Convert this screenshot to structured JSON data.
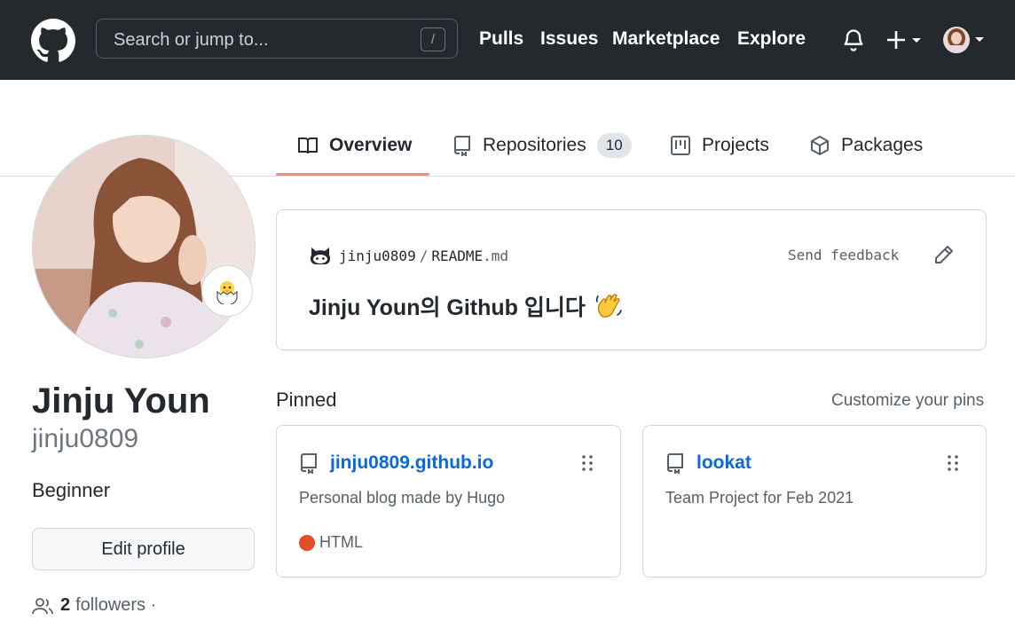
{
  "header": {
    "search_placeholder": "Search or jump to...",
    "search_shortcut": "/",
    "nav": [
      "Pulls",
      "Issues",
      "Marketplace",
      "Explore"
    ],
    "plus_icon": "plus-icon",
    "bell_icon": "bell-icon"
  },
  "tabs": [
    {
      "label": "Overview",
      "icon": "book-icon",
      "selected": true
    },
    {
      "label": "Repositories",
      "icon": "repo-icon",
      "count": "10"
    },
    {
      "label": "Projects",
      "icon": "project-icon"
    },
    {
      "label": "Packages",
      "icon": "package-icon"
    }
  ],
  "profile": {
    "full_name": "Jinju Youn",
    "username": "jinju0809",
    "bio": "Beginner",
    "edit_label": "Edit profile",
    "followers_count": "2",
    "followers_label": "followers ·"
  },
  "readme": {
    "owner": "jinju0809",
    "separator": "/",
    "file": "README",
    "ext": ".md",
    "send_feedback": "Send feedback",
    "heading": "Jinju Youn의 Github 입니다"
  },
  "pinned": {
    "title": "Pinned",
    "customize": "Customize your pins",
    "items": [
      {
        "name": "jinju0809.github.io",
        "description": "Personal blog made by Hugo",
        "language": "HTML",
        "language_color": "#e34c26"
      },
      {
        "name": "lookat",
        "description": "Team Project for Feb 2021"
      }
    ]
  },
  "colors": {
    "header_bg": "#24292e",
    "link": "#0969da",
    "tab_underline": "#fd8c73"
  }
}
